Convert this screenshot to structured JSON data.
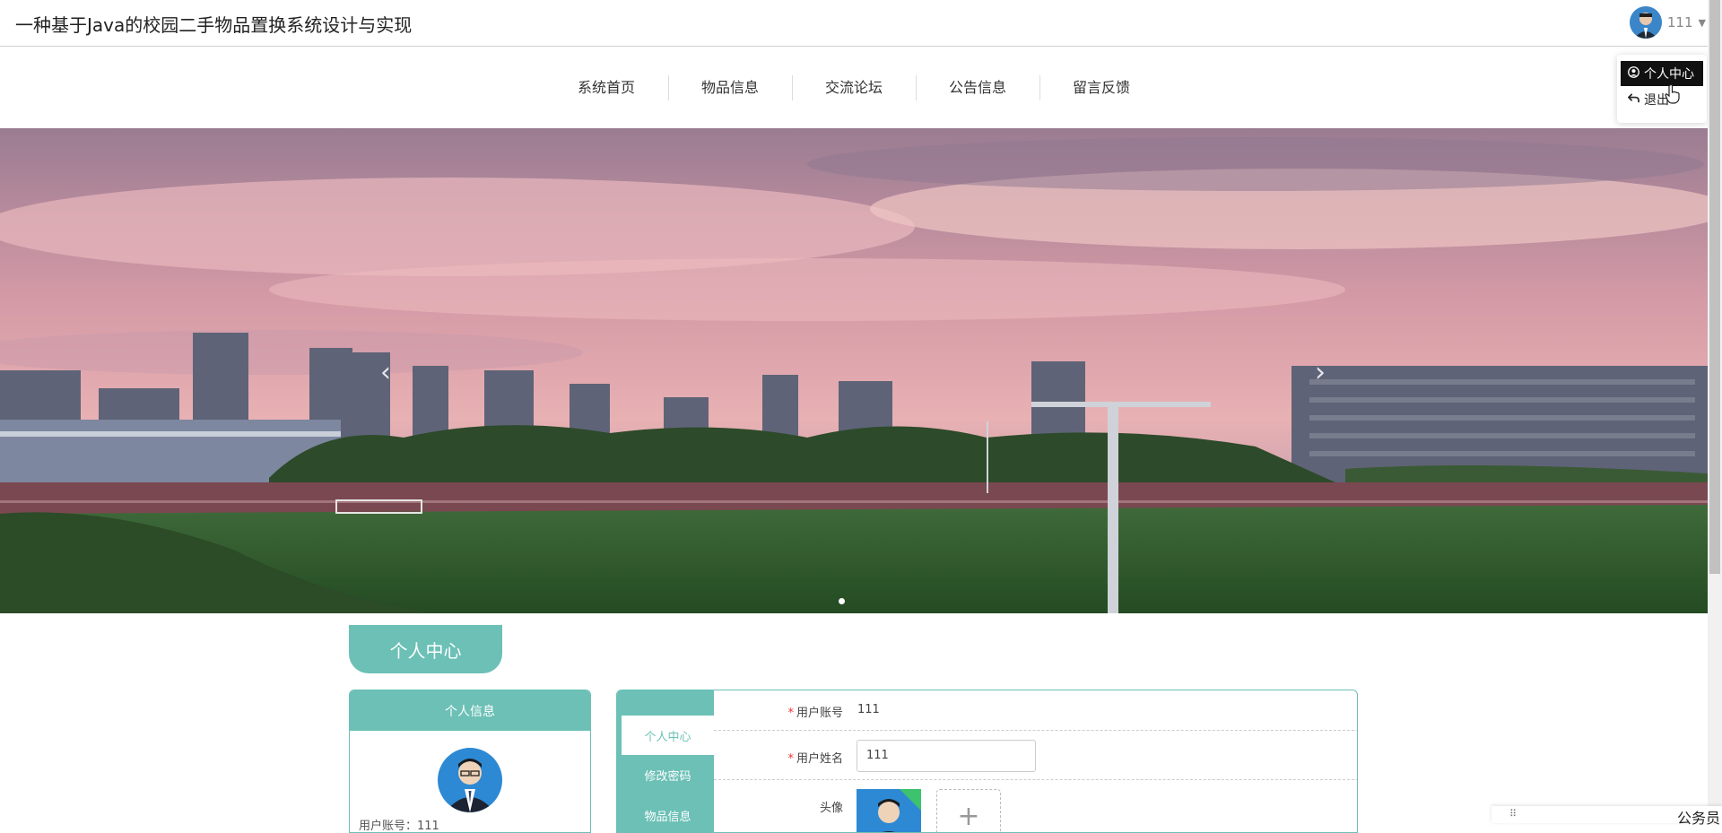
{
  "header": {
    "site_title": "一种基于Java的校园二手物品置换系统设计与实现",
    "username": "111",
    "caret": "▼"
  },
  "user_menu": {
    "items": [
      {
        "label": "个人中心",
        "icon": "user-circle-icon"
      },
      {
        "label": "退出",
        "icon": "logout-icon"
      }
    ]
  },
  "nav": {
    "items": [
      "系统首页",
      "物品信息",
      "交流论坛",
      "公告信息",
      "留言反馈"
    ]
  },
  "banner": {
    "prev": "‹",
    "next": "›"
  },
  "personal_center": {
    "title": "个人中心",
    "info_card_title": "个人信息",
    "info_account_label": "用户账号：111",
    "side_tabs": [
      "个人中心",
      "修改密码",
      "物品信息"
    ],
    "fields": {
      "account_label": "用户账号",
      "account_value": "111",
      "name_label": "用户姓名",
      "name_value": "111",
      "avatar_label": "头像",
      "upload_symbol": "+"
    }
  },
  "floater": {
    "text": "公务员",
    "grip": "⠿"
  },
  "colors": {
    "accent": "#6cc0b6",
    "required": "#ee3333"
  }
}
